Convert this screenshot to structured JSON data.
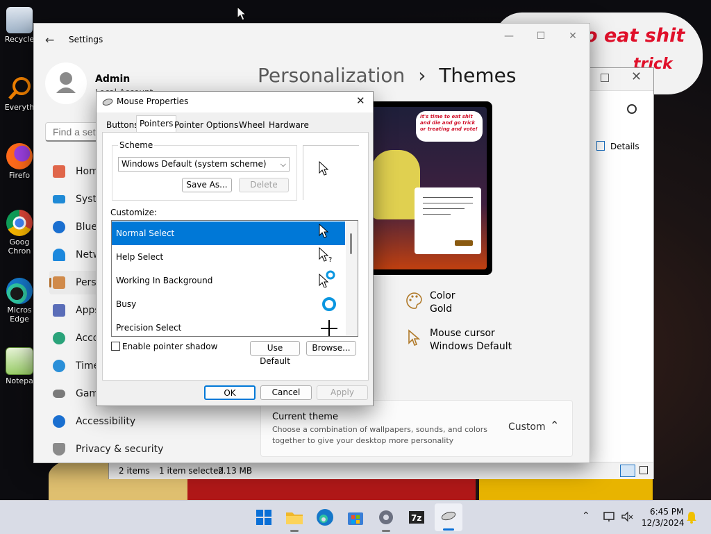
{
  "desktop": {
    "icons": [
      {
        "label": "Recycle",
        "icon": "recycle-bin-icon"
      },
      {
        "label": "Everyth",
        "icon": "everything-search-icon"
      },
      {
        "label": "Firefo",
        "icon": "firefox-icon"
      },
      {
        "label": "Goog",
        "label2": "Chron",
        "icon": "chrome-icon"
      },
      {
        "label": "Micros",
        "label2": "Edge",
        "icon": "edge-icon"
      },
      {
        "label": "Notepa",
        "icon": "notepad-icon"
      }
    ],
    "bubble": {
      "line1": "o eat shit",
      "line2": "trick"
    }
  },
  "settings": {
    "title": "Settings",
    "user": {
      "name": "Admin",
      "account": "Local Account"
    },
    "search_placeholder": "Find a sett",
    "breadcrumb": {
      "parent": "Personalization",
      "separator": "›",
      "current": "Themes"
    },
    "nav": [
      {
        "label": "Hom",
        "icon": "home-icon"
      },
      {
        "label": "Syste",
        "icon": "system-icon"
      },
      {
        "label": "Bluet",
        "icon": "bluetooth-icon"
      },
      {
        "label": "Netw",
        "icon": "network-icon"
      },
      {
        "label": "Perso",
        "icon": "personalization-icon"
      },
      {
        "label": "Apps",
        "icon": "apps-icon"
      },
      {
        "label": "Acco",
        "icon": "accounts-icon"
      },
      {
        "label": "Time",
        "icon": "time-icon"
      },
      {
        "label": "Gam",
        "icon": "gaming-icon"
      },
      {
        "label": "Accessibility",
        "icon": "accessibility-icon"
      },
      {
        "label": "Privacy & security",
        "icon": "shield-icon"
      }
    ],
    "preview_text": "It's time to eat shit and die and go trick or treating and vote!",
    "theme_props": [
      {
        "title": "Color",
        "value": "Gold",
        "icon": "palette-icon"
      },
      {
        "title": "Mouse cursor",
        "value": "Windows Default",
        "icon": "cursor-icon"
      }
    ],
    "current_theme": {
      "title": "Current theme",
      "desc": "Choose a combination of wallpapers, sounds, and colors together to give your desktop more personality",
      "value": "Custom"
    }
  },
  "explorer": {
    "details_label": "Details",
    "status": {
      "items": "2 items",
      "selected": "1 item selected",
      "size": "2.13 MB"
    }
  },
  "mouse_dialog": {
    "title": "Mouse Properties",
    "tabs": [
      "Buttons",
      "Pointers",
      "Pointer Options",
      "Wheel",
      "Hardware"
    ],
    "active_tab": "Pointers",
    "scheme_label": "Scheme",
    "scheme_value": "Windows Default (system scheme)",
    "save_as": "Save As...",
    "delete": "Delete",
    "customize_label": "Customize:",
    "pointers": [
      {
        "name": "Normal Select",
        "icon": "arrow-cursor-icon"
      },
      {
        "name": "Help Select",
        "icon": "help-cursor-icon"
      },
      {
        "name": "Working In Background",
        "icon": "working-cursor-icon"
      },
      {
        "name": "Busy",
        "icon": "busy-cursor-icon"
      },
      {
        "name": "Precision Select",
        "icon": "crosshair-cursor-icon"
      }
    ],
    "shadow_label": "Enable pointer shadow",
    "use_default": "Use Default",
    "browse": "Browse...",
    "ok": "OK",
    "cancel": "Cancel",
    "apply": "Apply"
  },
  "taskbar": {
    "time": "6:45 PM",
    "date": "12/3/2024"
  }
}
